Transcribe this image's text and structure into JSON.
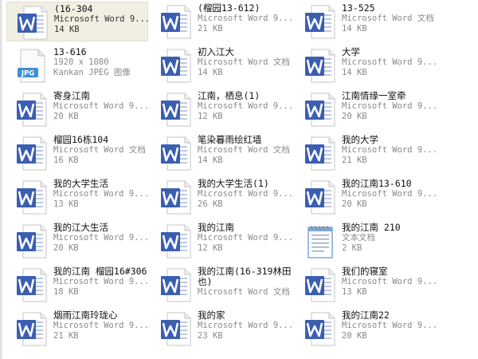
{
  "files": [
    {
      "name": "(16-304",
      "line2": "Microsoft Word 9...",
      "line3": "14 KB",
      "icon": "word-doc-icon",
      "selected": true
    },
    {
      "name": "(榴园13-612)",
      "line2": "Microsoft Word 9...",
      "line3": "21 KB",
      "icon": "word-doc-icon"
    },
    {
      "name": "13-525",
      "line2": "Microsoft Word 文档",
      "line3": "14 KB",
      "icon": "word-doc-icon"
    },
    {
      "name": "13-616",
      "line2": "1920 x 1080",
      "line3": "Kankan JPEG 图像",
      "icon": "jpg-image-icon",
      "badge": "JPG"
    },
    {
      "name": "初入江大",
      "line2": "Microsoft Word 文档",
      "line3": "14 KB",
      "icon": "word-doc-icon"
    },
    {
      "name": "大学",
      "line2": "Microsoft Word 9...",
      "line3": "14 KB",
      "icon": "word-doc-icon"
    },
    {
      "name": "寄身江南",
      "line2": "Microsoft Word 9...",
      "line3": "20 KB",
      "icon": "word-doc-icon"
    },
    {
      "name": "江南，栖息(1)",
      "line2": "Microsoft Word 9...",
      "line3": "12 KB",
      "icon": "word-doc-icon"
    },
    {
      "name": "江南情缘一室牵",
      "line2": "Microsoft Word 9...",
      "line3": "20 KB",
      "icon": "word-doc-icon"
    },
    {
      "name": "榴园16栋104",
      "line2": "Microsoft Word 文档",
      "line3": "16 KB",
      "icon": "word-doc-icon"
    },
    {
      "name": "笔染暮雨绘红墙",
      "line2": "Microsoft Word 文档",
      "line3": "14 KB",
      "icon": "word-doc-icon"
    },
    {
      "name": "我的大学",
      "line2": "Microsoft Word 9...",
      "line3": "21 KB",
      "icon": "word-doc-icon"
    },
    {
      "name": "我的大学生活",
      "line2": "Microsoft Word 9...",
      "line3": "13 KB",
      "icon": "word-doc-icon"
    },
    {
      "name": "我的大学生活(1)",
      "line2": "Microsoft Word 9...",
      "line3": "26 KB",
      "icon": "word-doc-icon"
    },
    {
      "name": "我的江南13-610",
      "line2": "Microsoft Word 9...",
      "line3": "20 KB",
      "icon": "word-doc-icon"
    },
    {
      "name": "我的江大生活",
      "line2": "Microsoft Word 9...",
      "line3": "20 KB",
      "icon": "word-doc-icon"
    },
    {
      "name": "我的江南",
      "line2": "Microsoft Word 9...",
      "line3": "12 KB",
      "icon": "word-doc-icon"
    },
    {
      "name": "我的江南 210",
      "line2": "文本文档",
      "line3": "2 KB",
      "icon": "text-doc-icon"
    },
    {
      "name": "我的江南 榴园16#306",
      "line2": "Microsoft Word 9...",
      "line3": "18 KB",
      "icon": "word-doc-icon"
    },
    {
      "name": "我的江南(16-319林田也)",
      "line2": "Microsoft Word 文档",
      "line3": "",
      "icon": "word-doc-icon",
      "wrap": true
    },
    {
      "name": "我们的寝室",
      "line2": "Microsoft Word 9...",
      "line3": "13 KB",
      "icon": "word-doc-icon"
    },
    {
      "name": "烟雨江南玲珑心",
      "line2": "Microsoft Word 9...",
      "line3": "21 KB",
      "icon": "word-doc-icon"
    },
    {
      "name": "我的家",
      "line2": "Microsoft Word 9...",
      "line3": "23 KB",
      "icon": "word-doc-icon"
    },
    {
      "name": "我的江南22",
      "line2": "Microsoft Word 9...",
      "line3": "20 KB",
      "icon": "word-doc-icon"
    }
  ],
  "colors": {
    "word_blue": "#3b5fb0",
    "page_white": "#ffffff",
    "page_border": "#c4c4c4",
    "jpg_badge": "#3f8fd6",
    "notepad_blue": "#7ea7d8",
    "selection": "#f0efe2"
  }
}
